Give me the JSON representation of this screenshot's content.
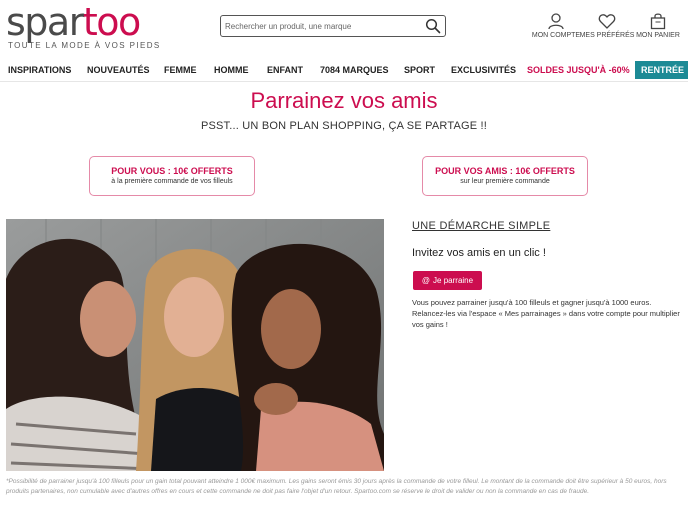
{
  "header": {
    "logo_main": "spar",
    "logo_accent": "too",
    "tagline": "TOUTE LA MODE À VOS PIEDS",
    "search_placeholder": "Rechercher un produit, une marque",
    "account_label": "MON COMPTE",
    "favorites_label": "MES PRÉFÉRÉS",
    "cart_label": "MON PANIER"
  },
  "nav": {
    "items": [
      "INSPIRATIONS",
      "NOUVEAUTÉS",
      "FEMME",
      "HOMME",
      "ENFANT",
      "7084 MARQUES",
      "SPORT",
      "EXCLUSIVITÉS"
    ],
    "sale": "SOLDES JUSQU'À -60%",
    "rentree": "RENTRÉE"
  },
  "page": {
    "title": "Parrainez vos amis",
    "subtitle": "PSST... UN BON PLAN SHOPPING, ÇA SE PARTAGE !!"
  },
  "offers": [
    {
      "title": "POUR VOUS : 10€ OFFERTS",
      "sub": "à la première commande de vos filleuls"
    },
    {
      "title": "POUR VOS AMIS : 10€ OFFERTS",
      "sub": "sur leur première commande"
    }
  ],
  "side": {
    "heading": "UNE DÉMARCHE SIMPLE",
    "invite": "Invitez vos amis en un clic !",
    "button_icon": "@",
    "button_label": "Je parraine",
    "info_line1": "Vous pouvez parrainer jusqu'à 100 filleuls et gagner jusqu'à 1000 euros.",
    "info_line2": "Relancez-les via l'espace « Mes parrainages » dans votre compte pour multiplier vos gains !"
  },
  "footnote": "*Possibilité de parrainer jusqu'à 100 filleuls pour un gain total pouvant atteindre 1 000€ maximum. Les gains seront émis 30 jours après la commande de votre filleul. Le montant de la commande doit être supérieur à 50 euros, hors produits partenaires, non cumulable avec d'autres offres en cours et cette commande ne doit pas faire l'objet d'un retour. Spartoo.com se réserve le droit de valider ou non la commande en cas de fraude.",
  "colors": {
    "brand": "#cc0d4f",
    "rentree_bg": "#1c8a95"
  },
  "icons": {
    "search": "search-icon",
    "account": "user-icon",
    "favorites": "heart-icon",
    "cart": "bag-icon"
  }
}
